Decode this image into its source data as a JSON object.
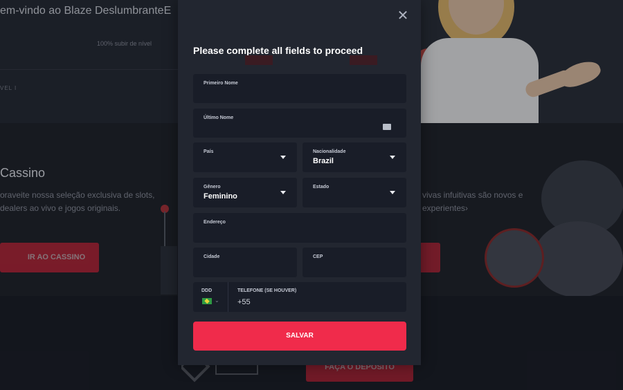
{
  "background": {
    "welcome": "em-vindo ao Blaze DeslumbranteE",
    "level_progress": "100% subir de nível",
    "level_label": "VEL I",
    "casino_title": "Cassino",
    "casino_desc": "oraveite nossa seleção exclusiva de slots, dealers ao vivo e jogos originais.",
    "casino_button": "IR AO CASSINO",
    "sports_desc": "vivas infuitivas são novos e experientes›",
    "deposit_button": "FAÇA O DEPÓSITO"
  },
  "modal": {
    "title": "Please complete all fields to proceed",
    "fields": {
      "first_name": {
        "label": "Primeiro Nome",
        "value": ""
      },
      "last_name": {
        "label": "Último Nome",
        "value": ""
      },
      "country": {
        "label": "País",
        "value": ""
      },
      "nationality": {
        "label": "Nacionalidade",
        "value": "Brazil"
      },
      "gender": {
        "label": "Gênero",
        "value": "Feminino"
      },
      "state": {
        "label": "Estado",
        "value": ""
      },
      "address": {
        "label": "Endereço",
        "value": ""
      },
      "city": {
        "label": "Cidade",
        "value": ""
      },
      "cep": {
        "label": "CEP",
        "value": ""
      },
      "ddd": {
        "label": "DDD"
      },
      "phone": {
        "label": "TELEFONE (SE HOUVER)",
        "value": "+55"
      }
    },
    "save_label": "SALVAR"
  },
  "colors": {
    "accent": "#f02b4b",
    "modal_bg": "#222630",
    "field_bg": "#191d28"
  }
}
